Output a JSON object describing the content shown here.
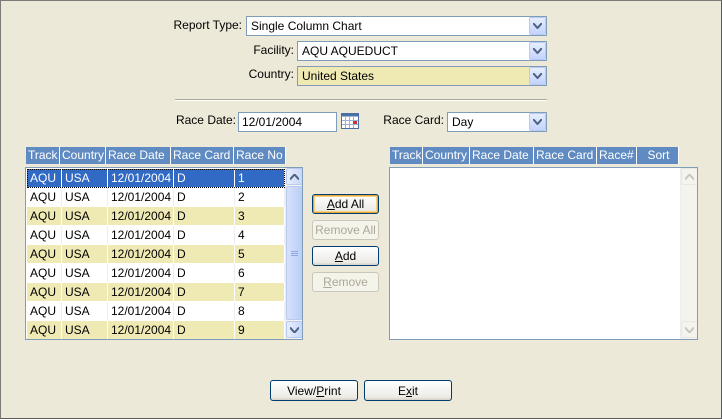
{
  "form": {
    "report_type": {
      "label": "Report Type:",
      "value": "Single Column Chart"
    },
    "facility": {
      "label": "Facility:",
      "value": "AQU AQUEDUCT"
    },
    "country": {
      "label": "Country:",
      "value": "United States"
    },
    "race_date": {
      "label": "Race Date:",
      "value": "12/01/2004"
    },
    "race_card": {
      "label": "Race Card:",
      "value": "Day"
    }
  },
  "left_grid": {
    "headers": [
      "Track",
      "Country",
      "Race Date",
      "Race Card",
      "Race No"
    ],
    "rows": [
      {
        "track": "AQU",
        "country": "USA",
        "date": "12/01/2004",
        "card": "D",
        "no": "1"
      },
      {
        "track": "AQU",
        "country": "USA",
        "date": "12/01/2004",
        "card": "D",
        "no": "2"
      },
      {
        "track": "AQU",
        "country": "USA",
        "date": "12/01/2004",
        "card": "D",
        "no": "3"
      },
      {
        "track": "AQU",
        "country": "USA",
        "date": "12/01/2004",
        "card": "D",
        "no": "4"
      },
      {
        "track": "AQU",
        "country": "USA",
        "date": "12/01/2004",
        "card": "D",
        "no": "5"
      },
      {
        "track": "AQU",
        "country": "USA",
        "date": "12/01/2004",
        "card": "D",
        "no": "6"
      },
      {
        "track": "AQU",
        "country": "USA",
        "date": "12/01/2004",
        "card": "D",
        "no": "7"
      },
      {
        "track": "AQU",
        "country": "USA",
        "date": "12/01/2004",
        "card": "D",
        "no": "8"
      },
      {
        "track": "AQU",
        "country": "USA",
        "date": "12/01/2004",
        "card": "D",
        "no": "9"
      }
    ]
  },
  "right_grid": {
    "headers": [
      "Track",
      "Country",
      "Race Date",
      "Race Card",
      "Race#",
      "Sort"
    ]
  },
  "buttons": {
    "add_all": {
      "pre": "",
      "key": "A",
      "post": "dd All"
    },
    "remove_all": {
      "pre": "",
      "key": "",
      "post": "Remove All"
    },
    "add": {
      "pre": "",
      "key": "A",
      "post": "dd"
    },
    "remove": {
      "pre": "",
      "key": "R",
      "post": "emove"
    },
    "view_print": {
      "pre": "View/",
      "key": "P",
      "post": "rint"
    },
    "exit": {
      "pre": "E",
      "key": "x",
      "post": "it"
    }
  },
  "colors": {
    "header_bg": "#5F8BC2",
    "row_alt": "#EFE9B4",
    "selection": "#316AC5",
    "window_bg": "#ECE9D8"
  }
}
